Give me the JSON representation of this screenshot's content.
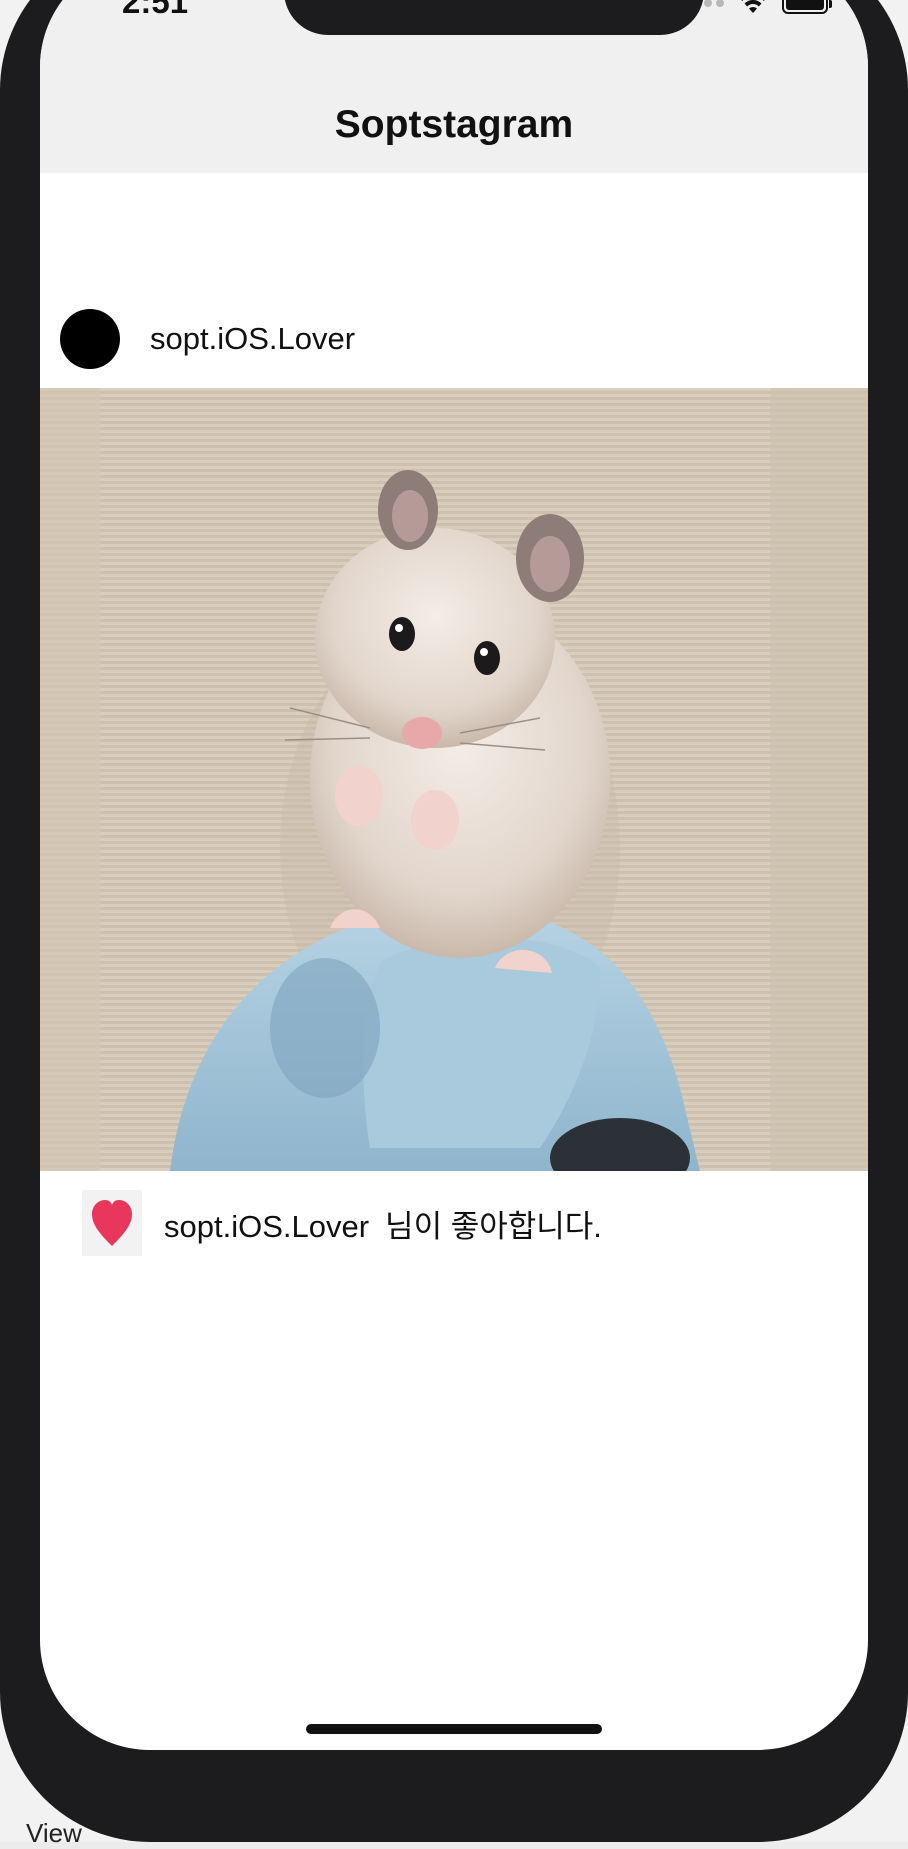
{
  "status_bar": {
    "time": "2:51",
    "icons": [
      "cellular-signal-icon",
      "wifi-icon",
      "battery-icon"
    ]
  },
  "nav": {
    "title": "Soptstagram"
  },
  "post": {
    "author": "sopt.iOS.Lover",
    "photo_subject": "hamster",
    "likes": {
      "user": "sopt.iOS.Lover",
      "suffix": "님이 좋아합니다.",
      "icon": "heart-icon",
      "heart_color": "#e8365d"
    }
  },
  "below_frame_text": "View"
}
